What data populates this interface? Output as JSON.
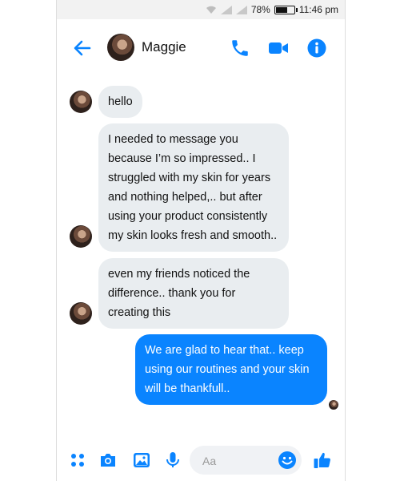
{
  "status_bar": {
    "battery": "78%",
    "time": "11:46 pm"
  },
  "header": {
    "contact_name": "Maggie"
  },
  "messages": [
    {
      "from": "contact",
      "text": "hello"
    },
    {
      "from": "contact",
      "text": "I needed to message you because I’m so impressed.. I struggled with my skin for years and nothing helped,.. but after using your product consistently my skin looks fresh and smooth.."
    },
    {
      "from": "contact",
      "text": "even my friends noticed the difference.. thank you for creating this"
    },
    {
      "from": "me",
      "text": "We are glad to hear that.. keep using our routines and your skin will be thankfull.."
    }
  ],
  "composer": {
    "placeholder": "Aa"
  },
  "icons": {
    "back": "arrow-left-icon",
    "call": "phone-icon",
    "video": "video-camera-icon",
    "info": "info-icon",
    "menu": "dots-grid-icon",
    "camera": "camera-icon",
    "gallery": "image-icon",
    "mic": "microphone-icon",
    "emoji": "smiley-icon",
    "like": "thumbs-up-icon"
  },
  "colors": {
    "accent": "#0a84ff",
    "incoming_bubble": "#e9edf0",
    "status_bar": "#f2f2f2"
  }
}
